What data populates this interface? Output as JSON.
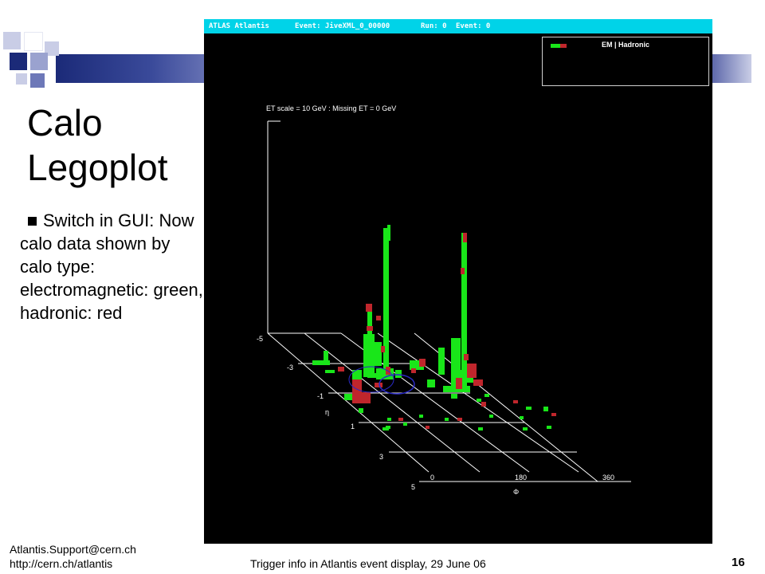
{
  "slide": {
    "title_line1": "Calo",
    "title_line2": "Legoplot",
    "bullet": "Switch in GUI: Now calo data shown by calo type: electromagnetic: green, hadronic: red"
  },
  "atlantis": {
    "app_name": "ATLAS Atlantis",
    "event": "Event: JiveXML_0_00000",
    "run": "Run: 0",
    "event_no": "Event: 0",
    "legend_label": "EM | Hadronic",
    "et_scale": "ET scale = 10 GeV : Missing ET = 0 GeV",
    "eta_label": "η",
    "phi_label": "Φ",
    "eta_ticks": [
      "-5",
      "-3",
      "-1",
      "1",
      "3",
      "5"
    ],
    "phi_ticks": [
      "0",
      "180",
      "360"
    ],
    "colors": {
      "em": "#19e619",
      "hadronic": "#c0262c",
      "titlebar": "#00d3e8"
    }
  },
  "footer": {
    "email": "Atlantis.Support@cern.ch",
    "url": "http://cern.ch/atlantis",
    "center": "Trigger info in Atlantis event display, 29 June 06",
    "page": "16"
  }
}
